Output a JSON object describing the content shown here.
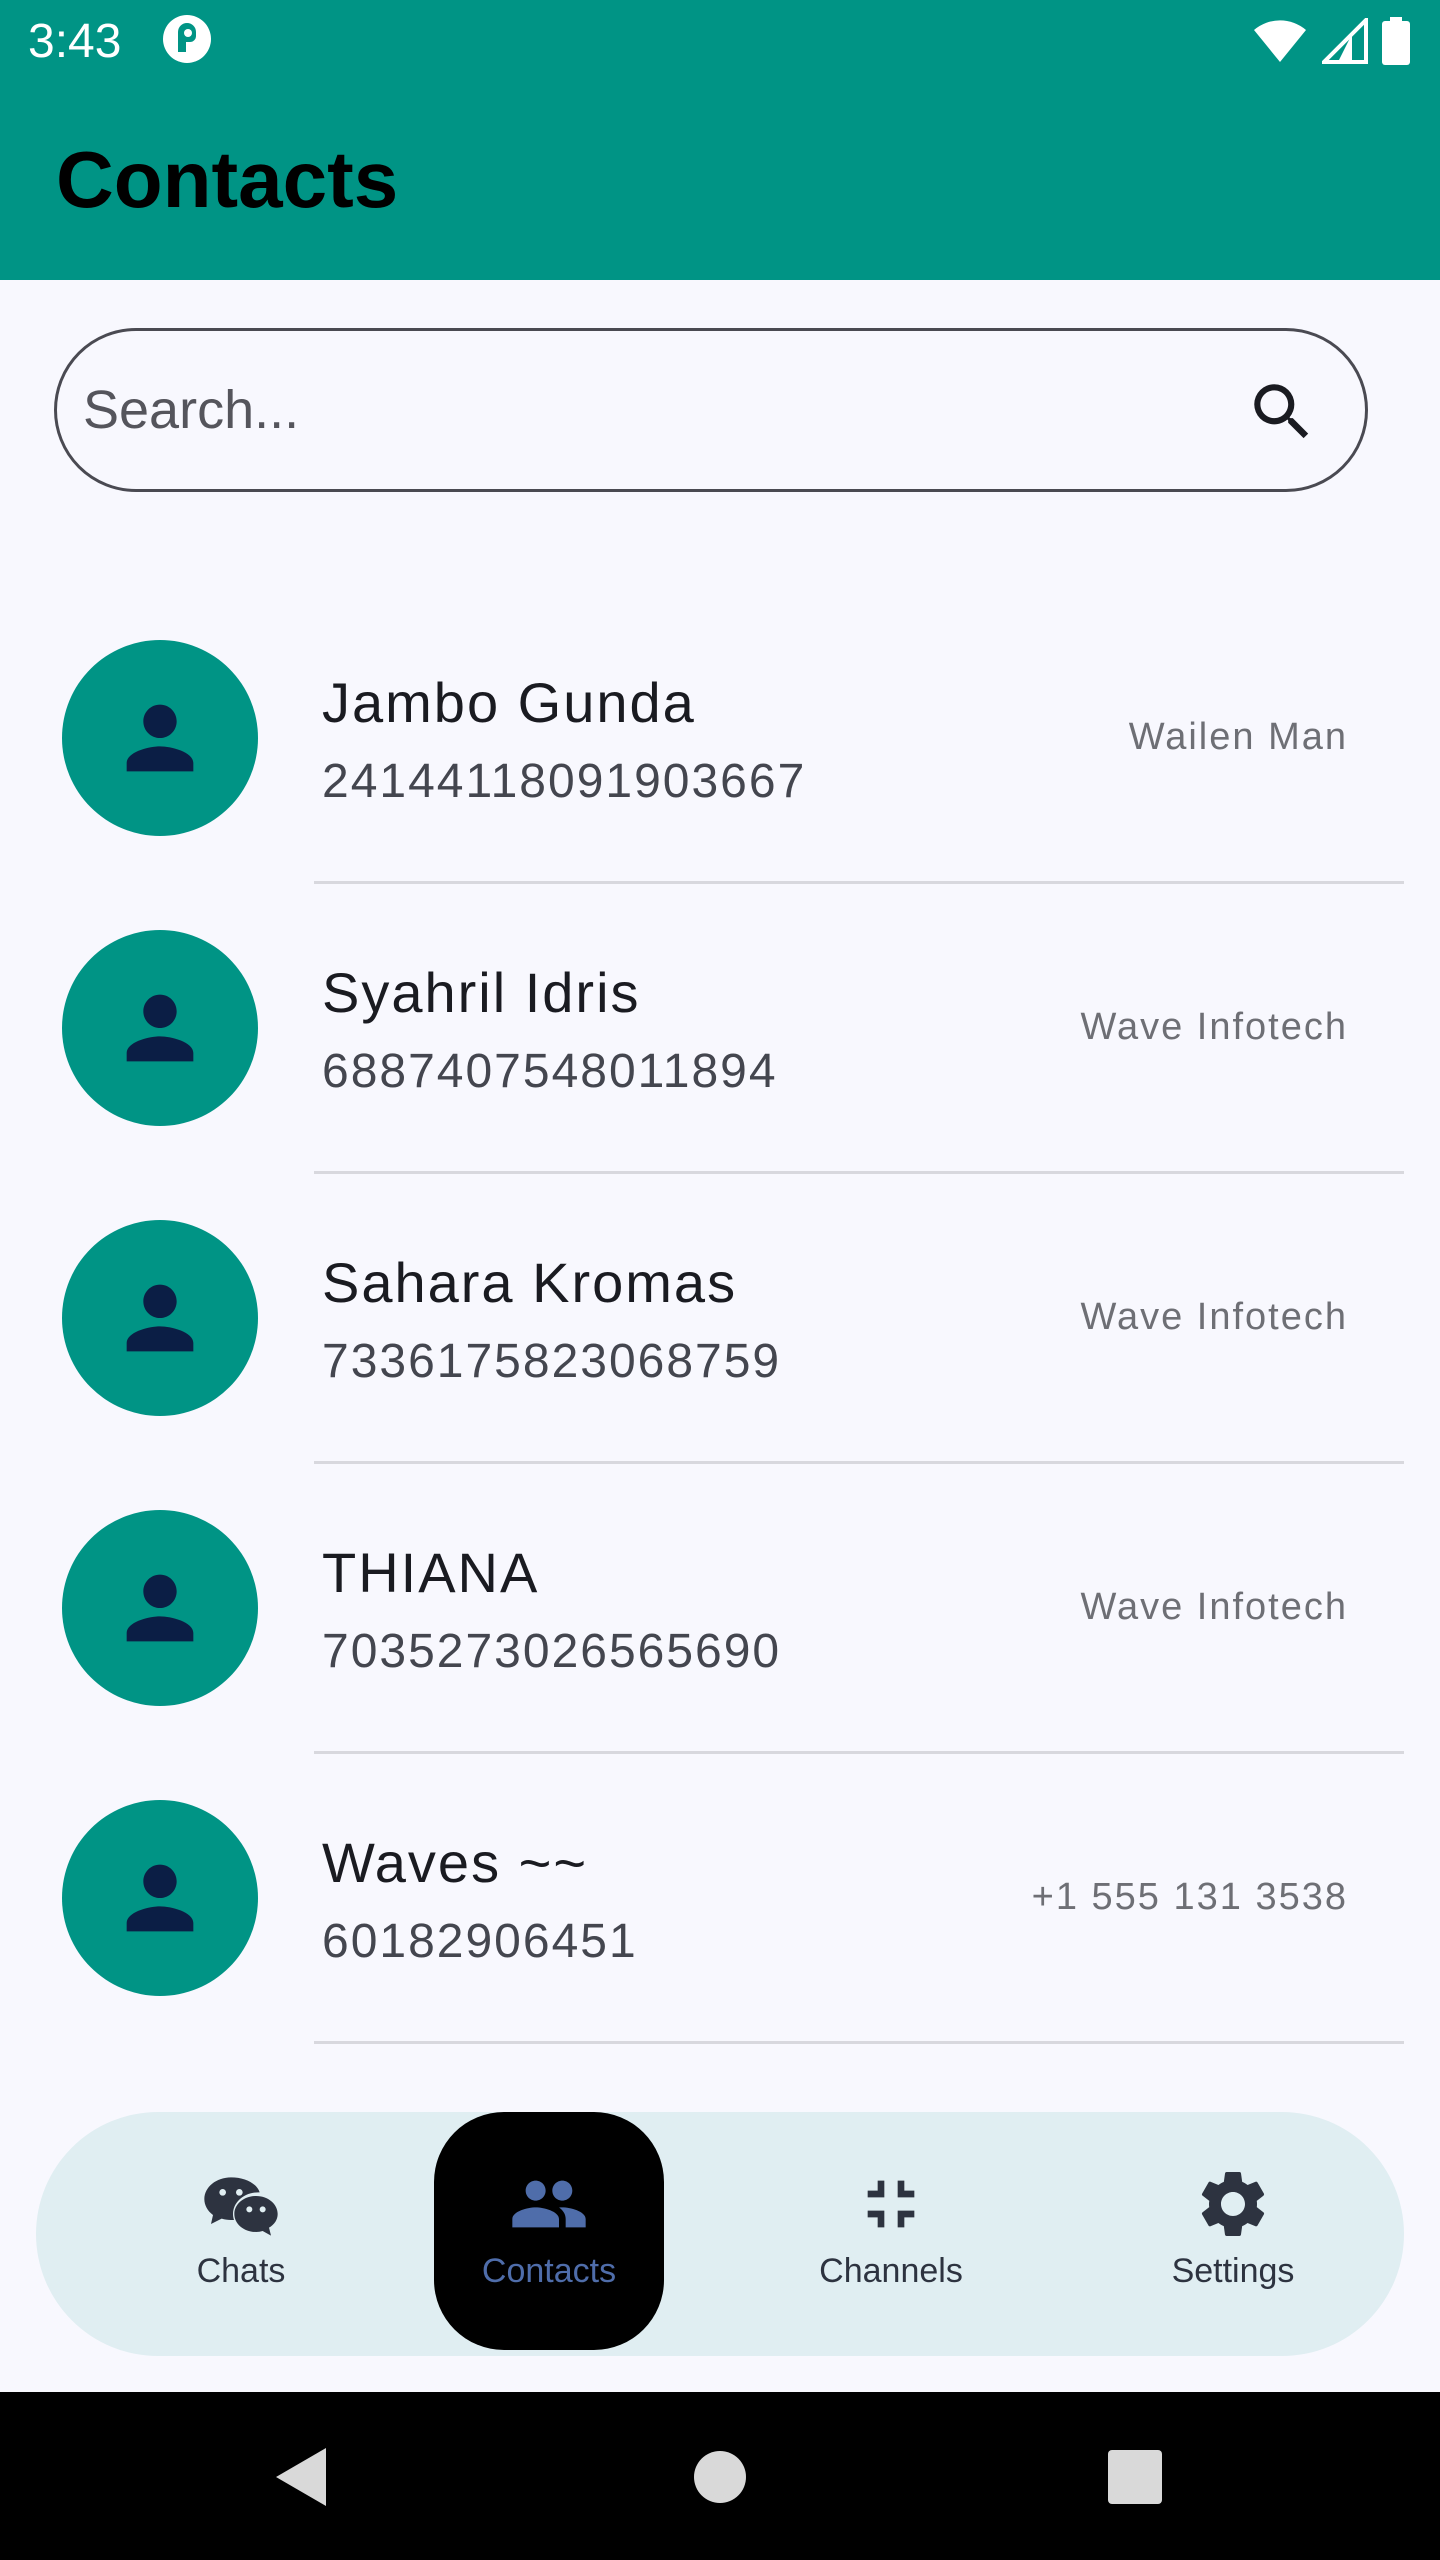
{
  "status_bar": {
    "time": "3:43"
  },
  "app_bar": {
    "title": "Contacts"
  },
  "search": {
    "placeholder": "Search..."
  },
  "contacts": [
    {
      "name": "Jambo Gunda",
      "number": "24144118091903667",
      "org": "Wailen Man"
    },
    {
      "name": "Syahril Idris",
      "number": "6887407548011894",
      "org": "Wave Infotech"
    },
    {
      "name": "Sahara Kromas",
      "number": "7336175823068759",
      "org": "Wave Infotech"
    },
    {
      "name": "THIANA",
      "number": "7035273026565690",
      "org": "Wave Infotech"
    },
    {
      "name": "Waves ~~",
      "number": "60182906451",
      "org": "+1 555 131 3538"
    }
  ],
  "bottom_nav": {
    "items": [
      {
        "label": "Chats",
        "icon": "chats-icon"
      },
      {
        "label": "Contacts",
        "icon": "contacts-icon",
        "active": true
      },
      {
        "label": "Channels",
        "icon": "channels-icon"
      },
      {
        "label": "Settings",
        "icon": "settings-icon"
      }
    ]
  },
  "colors": {
    "primary": "#009485",
    "avatar_icon": "#0B1E45",
    "nav_background": "#E0EEF2",
    "nav_active_label": "#4F6DAA"
  }
}
